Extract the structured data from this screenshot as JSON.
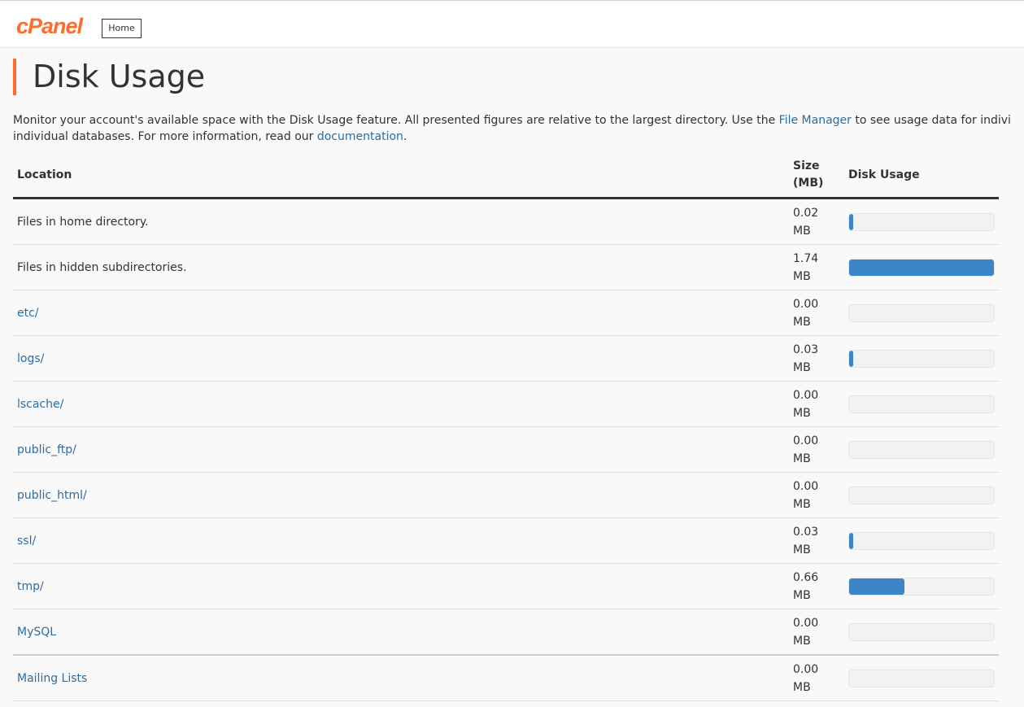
{
  "header": {
    "logo_text": "cPanel",
    "home_label": "Home"
  },
  "page": {
    "title": "Disk Usage",
    "description_part1": "Monitor your account's available space with the Disk Usage feature. All presented figures are relative to the largest directory. Use the ",
    "file_manager_link": "File Manager",
    "description_part2": " to see usage data for indivi",
    "description_line2_part1": "individual databases. For more information, read our ",
    "documentation_link": "documentation",
    "description_line2_part2": "."
  },
  "table": {
    "headers": {
      "location": "Location",
      "size_line1": "Size",
      "size_line2": "(MB)",
      "usage": "Disk Usage"
    },
    "rows": [
      {
        "location": "Files in home directory.",
        "link": false,
        "size": "0.02",
        "unit": "MB",
        "fill": 0.03
      },
      {
        "location": "Files in hidden subdirectories.",
        "link": false,
        "size": "1.74",
        "unit": "MB",
        "fill": 1.0
      },
      {
        "location": "etc/",
        "link": true,
        "size": "0.00",
        "unit": "MB",
        "fill": 0
      },
      {
        "location": "logs/",
        "link": true,
        "size": "0.03",
        "unit": "MB",
        "fill": 0.03
      },
      {
        "location": "lscache/",
        "link": true,
        "size": "0.00",
        "unit": "MB",
        "fill": 0
      },
      {
        "location": "public_ftp/",
        "link": true,
        "size": "0.00",
        "unit": "MB",
        "fill": 0
      },
      {
        "location": "public_html/",
        "link": true,
        "size": "0.00",
        "unit": "MB",
        "fill": 0
      },
      {
        "location": "ssl/",
        "link": true,
        "size": "0.03",
        "unit": "MB",
        "fill": 0.03
      },
      {
        "location": "tmp/",
        "link": true,
        "size": "0.66",
        "unit": "MB",
        "fill": 0.38
      },
      {
        "location": "MySQL",
        "link": true,
        "size": "0.00",
        "unit": "MB",
        "fill": 0
      },
      {
        "location": "Mailing Lists",
        "link": true,
        "size": "0.00",
        "unit": "MB",
        "fill": 0
      }
    ]
  },
  "colors": {
    "brand": "#ff6c2c",
    "link": "#2d6ca2",
    "bar_fill": "#3d85c6"
  }
}
